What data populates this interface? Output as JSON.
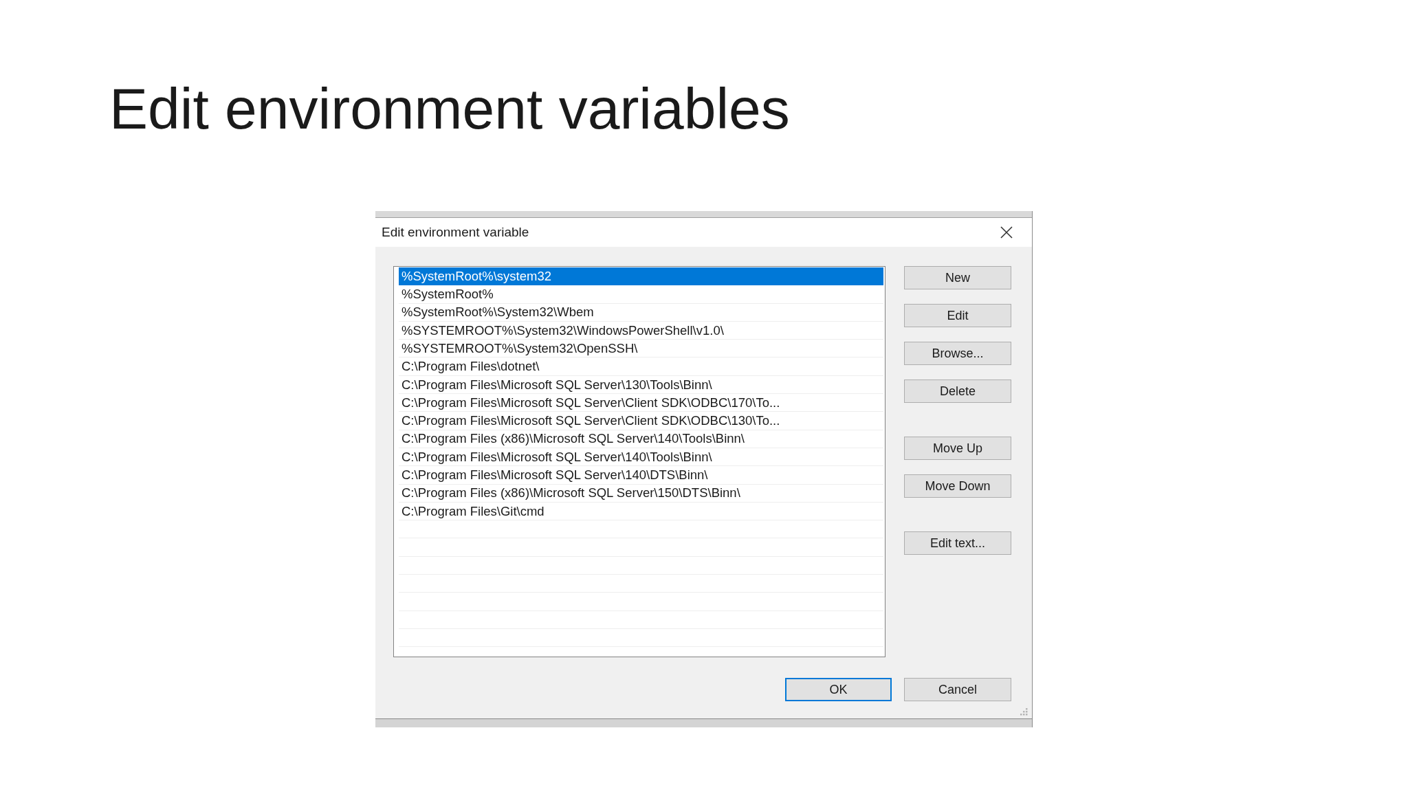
{
  "slide": {
    "title": "Edit environment variables"
  },
  "dialog": {
    "title": "Edit environment variable",
    "entries": [
      {
        "text": "%SystemRoot%\\system32",
        "selected": true
      },
      {
        "text": "%SystemRoot%",
        "selected": false
      },
      {
        "text": "%SystemRoot%\\System32\\Wbem",
        "selected": false
      },
      {
        "text": "%SYSTEMROOT%\\System32\\WindowsPowerShell\\v1.0\\",
        "selected": false
      },
      {
        "text": "%SYSTEMROOT%\\System32\\OpenSSH\\",
        "selected": false
      },
      {
        "text": "C:\\Program Files\\dotnet\\",
        "selected": false
      },
      {
        "text": "C:\\Program Files\\Microsoft SQL Server\\130\\Tools\\Binn\\",
        "selected": false
      },
      {
        "text": "C:\\Program Files\\Microsoft SQL Server\\Client SDK\\ODBC\\170\\To...",
        "selected": false
      },
      {
        "text": "C:\\Program Files\\Microsoft SQL Server\\Client SDK\\ODBC\\130\\To...",
        "selected": false
      },
      {
        "text": "C:\\Program Files (x86)\\Microsoft SQL Server\\140\\Tools\\Binn\\",
        "selected": false
      },
      {
        "text": "C:\\Program Files\\Microsoft SQL Server\\140\\Tools\\Binn\\",
        "selected": false
      },
      {
        "text": "C:\\Program Files\\Microsoft SQL Server\\140\\DTS\\Binn\\",
        "selected": false
      },
      {
        "text": "C:\\Program Files (x86)\\Microsoft SQL Server\\150\\DTS\\Binn\\",
        "selected": false
      },
      {
        "text": "C:\\Program Files\\Git\\cmd",
        "selected": false
      }
    ],
    "side_button_groups": [
      [
        "New",
        "Edit",
        "Browse...",
        "Delete"
      ],
      [
        "Move Up",
        "Move Down"
      ],
      [
        "Edit text..."
      ]
    ],
    "footer_buttons": [
      {
        "label": "OK",
        "default": true
      },
      {
        "label": "Cancel",
        "default": false
      }
    ]
  }
}
